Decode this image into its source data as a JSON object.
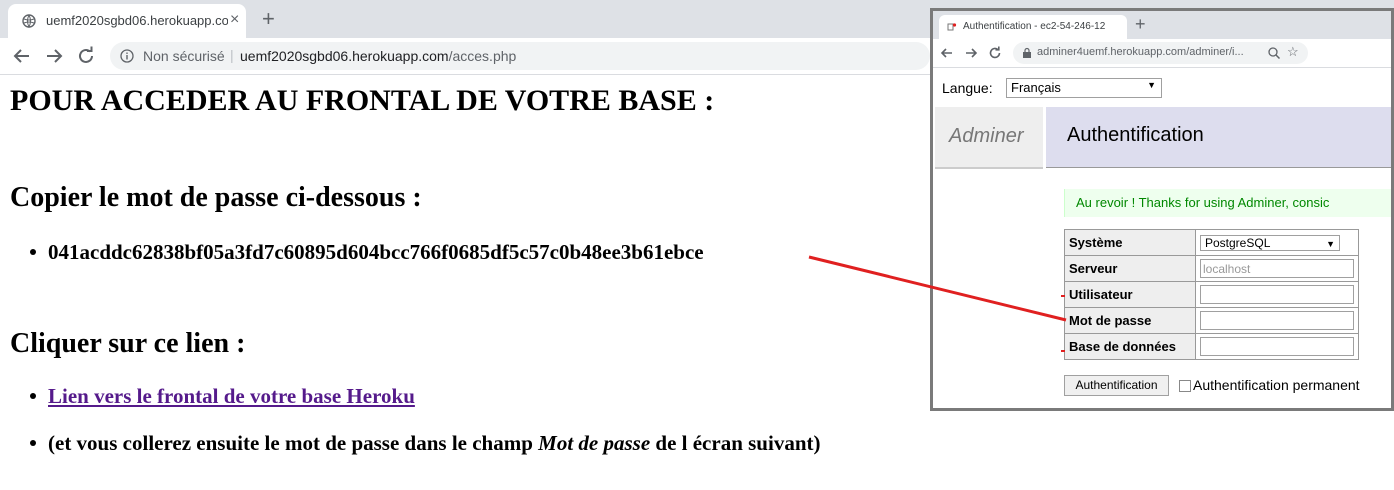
{
  "browser": {
    "tab_title": "uemf2020sgbd06.herokuapp.com",
    "tab_close": "×",
    "new_tab": "+",
    "security_label": "Non sécurisé",
    "separator": "|",
    "url_host": "uemf2020sgbd06.herokuapp.com",
    "url_path": "/acces.php"
  },
  "page": {
    "heading": "POUR ACCEDER AU FRONTAL DE VOTRE BASE :",
    "copy_heading": "Copier le mot de passe ci-dessous :",
    "password": "041acddc62838bf05a3fd7c60895d604bcc766f0685df5c57c0b48ee3b61ebce",
    "click_heading": "Cliquer sur ce lien :",
    "link_text": "Lien vers le frontal de votre base Heroku",
    "instruction_before": "(et vous collerez ensuite le mot de passe dans le champ ",
    "instruction_italic": "Mot de passe",
    "instruction_after": " de l écran suivant)"
  },
  "inset": {
    "tab_title": "Authentification - ec2-54-246-12",
    "new_tab": "+",
    "url": "adminer4uemf.herokuapp.com/adminer/i...",
    "langue_label": "Langue:",
    "langue_value": "Français",
    "adminer_label": "Adminer",
    "auth_heading": "Authentification",
    "message": "Au revoir ! Thanks for using Adminer, consic",
    "form": {
      "systeme_label": "Système",
      "systeme_value": "PostgreSQL",
      "serveur_label": "Serveur",
      "serveur_placeholder": "localhost",
      "utilisateur_label": "Utilisateur",
      "motdepasse_label": "Mot de passe",
      "base_label": "Base de données"
    },
    "submit_label": "Authentification",
    "permanent_label": "Authentification permanent"
  },
  "colors": {
    "arrow": "#e02020",
    "link": "#551a8b",
    "tabstrip": "#dee1e6"
  }
}
